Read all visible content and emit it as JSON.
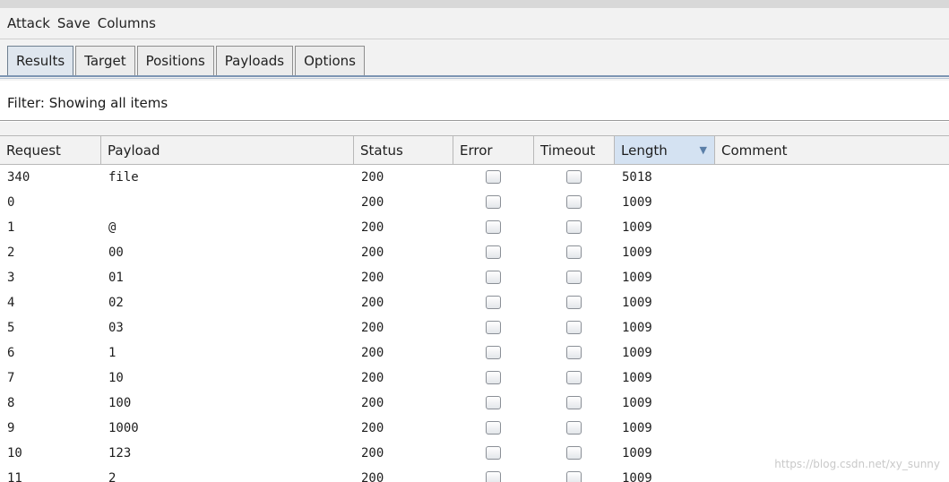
{
  "menu": [
    "Attack",
    "Save",
    "Columns"
  ],
  "tabs": [
    "Results",
    "Target",
    "Positions",
    "Payloads",
    "Options"
  ],
  "active_tab": "Results",
  "filter_text": "Filter: Showing all items",
  "columns": [
    "Request",
    "Payload",
    "Status",
    "Error",
    "Timeout",
    "Length",
    "Comment"
  ],
  "sorted_column": "Length",
  "rows": [
    {
      "request": "340",
      "payload": "file",
      "status": "200",
      "length": "5018",
      "comment": ""
    },
    {
      "request": "0",
      "payload": "",
      "status": "200",
      "length": "1009",
      "comment": ""
    },
    {
      "request": "1",
      "payload": "@",
      "status": "200",
      "length": "1009",
      "comment": ""
    },
    {
      "request": "2",
      "payload": "00",
      "status": "200",
      "length": "1009",
      "comment": ""
    },
    {
      "request": "3",
      "payload": "01",
      "status": "200",
      "length": "1009",
      "comment": ""
    },
    {
      "request": "4",
      "payload": "02",
      "status": "200",
      "length": "1009",
      "comment": ""
    },
    {
      "request": "5",
      "payload": "03",
      "status": "200",
      "length": "1009",
      "comment": ""
    },
    {
      "request": "6",
      "payload": "1",
      "status": "200",
      "length": "1009",
      "comment": ""
    },
    {
      "request": "7",
      "payload": "10",
      "status": "200",
      "length": "1009",
      "comment": ""
    },
    {
      "request": "8",
      "payload": "100",
      "status": "200",
      "length": "1009",
      "comment": ""
    },
    {
      "request": "9",
      "payload": "1000",
      "status": "200",
      "length": "1009",
      "comment": ""
    },
    {
      "request": "10",
      "payload": "123",
      "status": "200",
      "length": "1009",
      "comment": ""
    },
    {
      "request": "11",
      "payload": "2",
      "status": "200",
      "length": "1009",
      "comment": ""
    }
  ],
  "watermark": "https://blog.csdn.net/xy_sunny"
}
